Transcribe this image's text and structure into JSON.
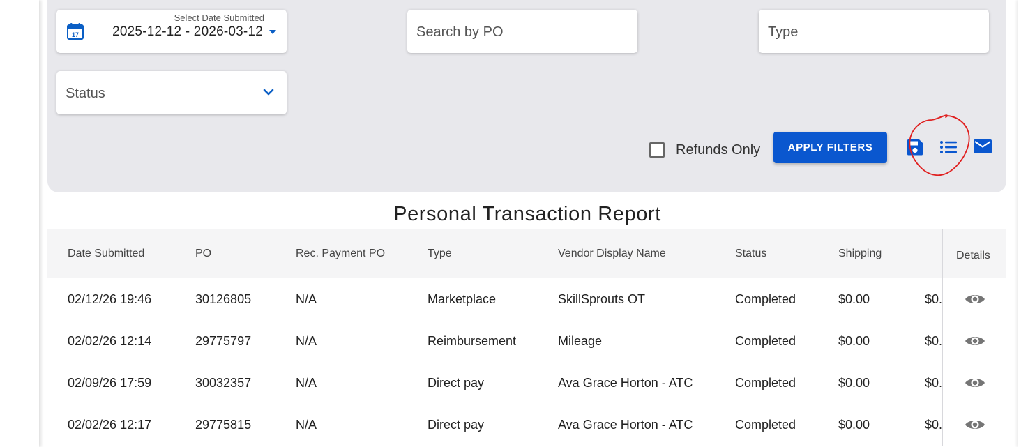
{
  "filters": {
    "date": {
      "label": "Select Date Submitted",
      "value": "2025-12-12 - 2026-03-12",
      "calendar_day": "17"
    },
    "po_search": {
      "placeholder": "Search by PO"
    },
    "type": {
      "placeholder": "Type"
    },
    "status": {
      "placeholder": "Status"
    },
    "refunds_only": {
      "label": "Refunds Only",
      "checked": false
    },
    "apply_label": "APPLY FILTERS",
    "icons": [
      "save-icon",
      "list-icon",
      "mail-icon"
    ],
    "accent_color": "#0a57cf"
  },
  "report": {
    "title": "Personal Transaction Report",
    "columns": [
      "Date Submitted",
      "PO",
      "Rec. Payment PO",
      "Type",
      "Vendor Display Name",
      "Status",
      "Shipping",
      "Details"
    ],
    "rows": [
      {
        "date": "02/12/26 19:46",
        "po": "30126805",
        "rec_po": "N/A",
        "type": "Marketplace",
        "vendor": "SkillSprouts OT",
        "status": "Completed",
        "shipping": "$0.00",
        "next": "$0."
      },
      {
        "date": "02/02/26 12:14",
        "po": "29775797",
        "rec_po": "N/A",
        "type": "Reimbursement",
        "vendor": "Mileage",
        "status": "Completed",
        "shipping": "$0.00",
        "next": "$0."
      },
      {
        "date": "02/09/26 17:59",
        "po": "30032357",
        "rec_po": "N/A",
        "type": "Direct pay",
        "vendor": "Ava Grace Horton - ATC",
        "status": "Completed",
        "shipping": "$0.00",
        "next": "$0."
      },
      {
        "date": "02/02/26 12:17",
        "po": "29775815",
        "rec_po": "N/A",
        "type": "Direct pay",
        "vendor": "Ava Grace Horton - ATC",
        "status": "Completed",
        "shipping": "$0.00",
        "next": "$0."
      }
    ]
  }
}
